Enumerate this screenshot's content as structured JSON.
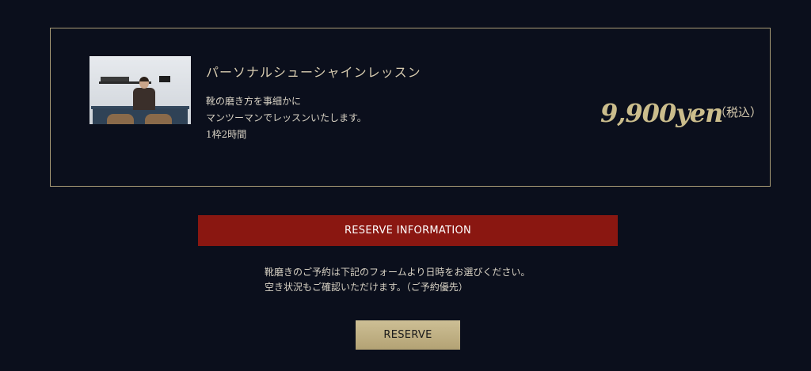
{
  "course": {
    "title": "パーソナルシューシャインレッスン",
    "description": [
      "靴の磨き方を事細かに",
      "マンツーマンでレッスンいたします。",
      "1枠2時間"
    ],
    "price": "9,900yen",
    "tax_note": "（税込）"
  },
  "reserve_info": {
    "heading": "RESERVE INFORMATION",
    "notice": [
      "靴磨きのご予約は下記のフォームより日時をお選びください。",
      "空き状況もご確認いただけます。（ご予約優先）"
    ]
  },
  "reserve_button": {
    "label": "RESERVE"
  },
  "colors": {
    "background": "#0b0f1c",
    "accent_gold": "#cbbd8c",
    "banner_red": "#8a1711"
  }
}
